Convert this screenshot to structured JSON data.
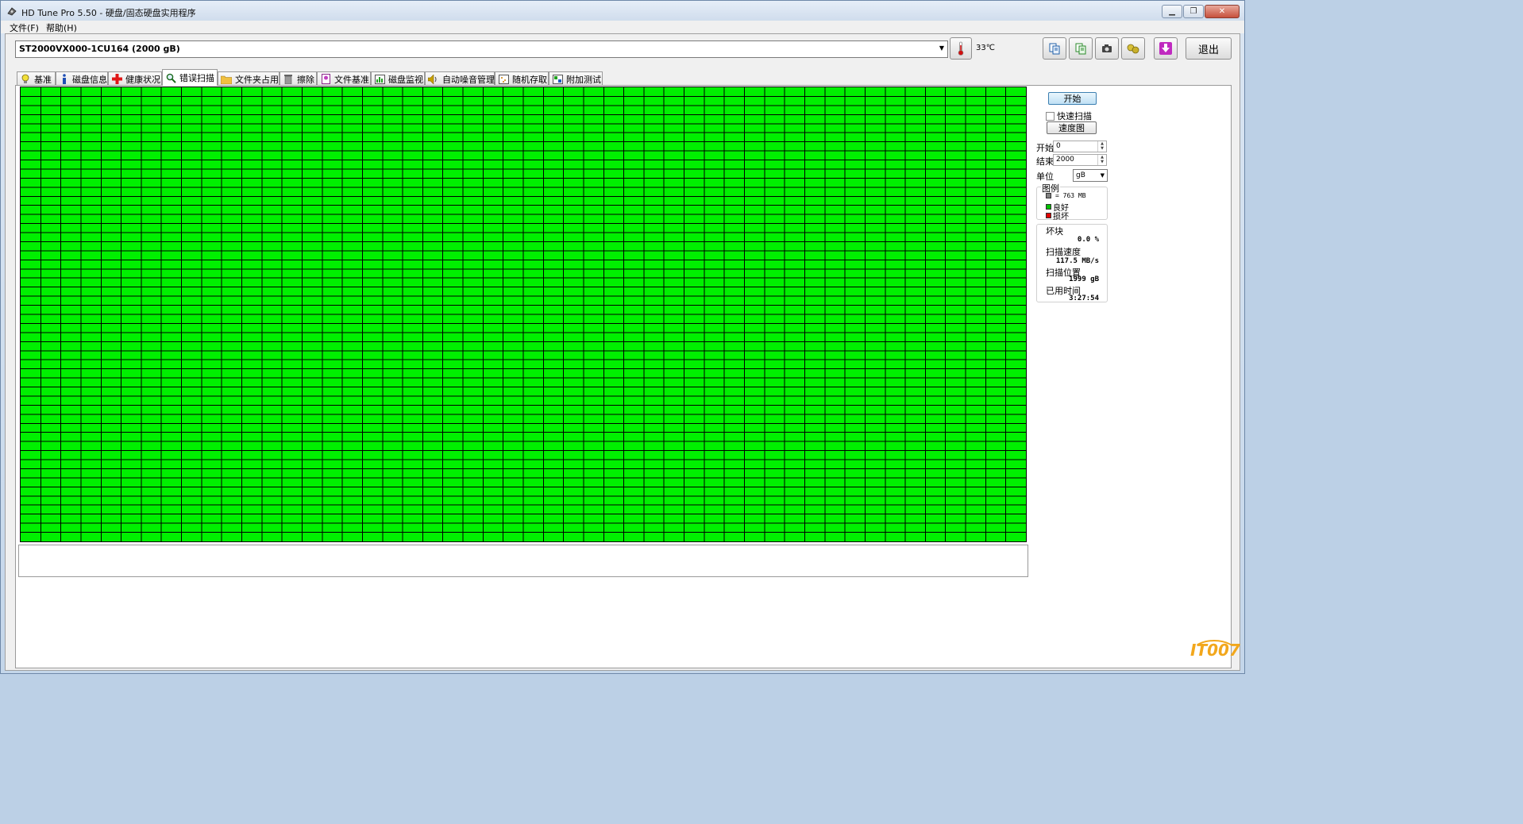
{
  "window": {
    "title": "HD Tune Pro 5.50 - 硬盘/固态硬盘实用程序"
  },
  "menu": {
    "file": "文件(F)",
    "help": "帮助(H)"
  },
  "toolbar": {
    "drive": "ST2000VX000-1CU164 (2000 gB)",
    "temperature": "33℃",
    "exit_label": "退出"
  },
  "tabs": [
    {
      "label": "基准",
      "icon": "bulb-icon"
    },
    {
      "label": "磁盘信息",
      "icon": "info-icon"
    },
    {
      "label": "健康状况",
      "icon": "health-cross-icon"
    },
    {
      "label": "错误扫描",
      "icon": "magnifier-icon"
    },
    {
      "label": "文件夹占用",
      "icon": "folder-icon"
    },
    {
      "label": "擦除",
      "icon": "trash-icon"
    },
    {
      "label": "文件基准",
      "icon": "file-benchmark-icon"
    },
    {
      "label": "磁盘监视",
      "icon": "monitor-chart-icon"
    },
    {
      "label": "自动噪音管理",
      "icon": "speaker-icon"
    },
    {
      "label": "随机存取",
      "icon": "random-access-icon"
    },
    {
      "label": "附加测试",
      "icon": "extra-tests-icon"
    }
  ],
  "scan": {
    "start_button": "开始",
    "quick_scan_label": "快速扫描",
    "quick_scan_checked": false,
    "speed_map_button": "速度图",
    "start_label": "开始",
    "start_value": "0",
    "end_label": "结束",
    "end_value": "2000",
    "unit_label": "单位",
    "unit_value": "gB"
  },
  "legend": {
    "title": "图例",
    "block_size": "= 763 MB",
    "good": "良好",
    "damaged": "损坏"
  },
  "stats": {
    "bad_blocks_label": "坏块",
    "bad_blocks_value": "0.0 %",
    "scan_speed_label": "扫描速度",
    "scan_speed_value": "117.5 MB/s",
    "scan_position_label": "扫描位置",
    "scan_position_value": "1999 gB",
    "elapsed_label": "已用时间",
    "elapsed_value": "3:27:54"
  },
  "grid": {
    "columns": 50,
    "rows": 50,
    "good_color": "#00f000",
    "damaged_color": "#e00000",
    "unscanned_color": "#808080",
    "state": "all-good"
  },
  "watermark": "IT007"
}
